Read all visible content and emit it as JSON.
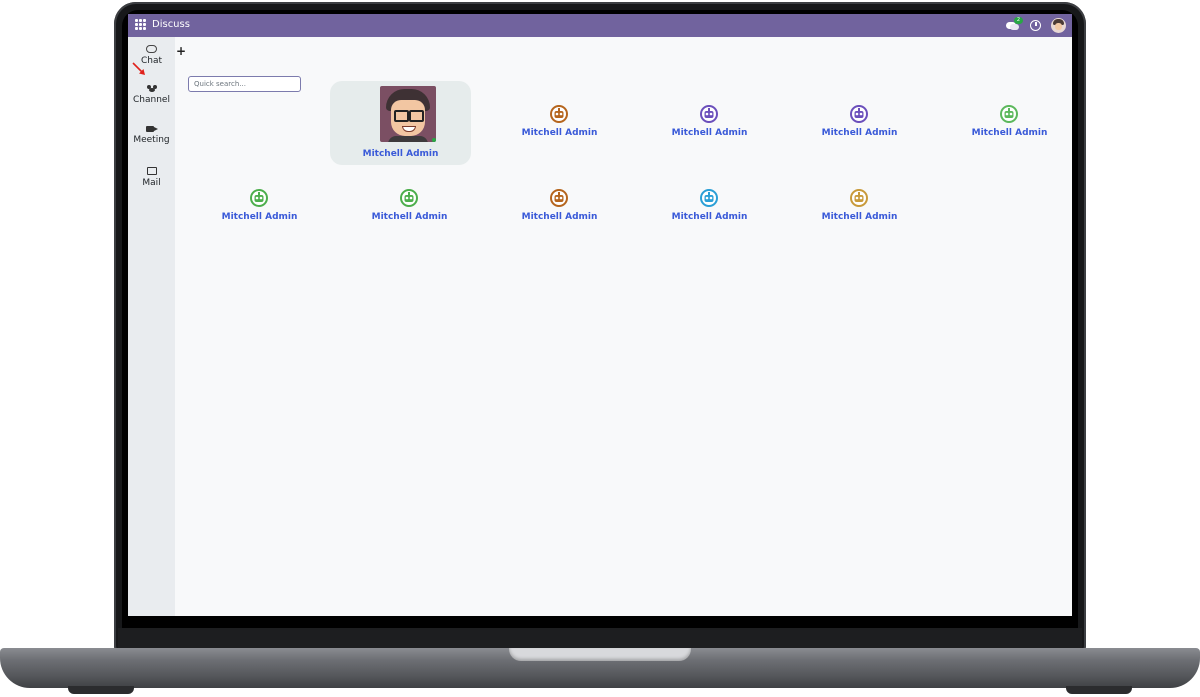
{
  "app": {
    "title": "Discuss"
  },
  "topbar": {
    "chat_badge": "2"
  },
  "sidebar": {
    "items": [
      {
        "label": "Chat",
        "icon": "chat-icon"
      },
      {
        "label": "Channel",
        "icon": "channel-icon"
      },
      {
        "label": "Meeting",
        "icon": "meeting-icon"
      },
      {
        "label": "Mail",
        "icon": "mail-icon"
      }
    ]
  },
  "search": {
    "placeholder": "Quick search..."
  },
  "contacts": [
    {
      "name": "Mitchell Admin",
      "avatar": "photo",
      "status": "online",
      "active": true
    },
    {
      "name": "Mitchell Admin",
      "avatar": "robot",
      "color": "#b5651d"
    },
    {
      "name": "Mitchell Admin",
      "avatar": "robot",
      "color": "#6b4fbb"
    },
    {
      "name": "Mitchell Admin",
      "avatar": "robot",
      "color": "#6b4fbb"
    },
    {
      "name": "Mitchell Admin",
      "avatar": "robot",
      "color": "#5cb85c"
    },
    {
      "name": "Mitchell Admin",
      "avatar": "robot",
      "color": "#4cae4c"
    },
    {
      "name": "Mitchell Admin",
      "avatar": "robot",
      "color": "#4cae4c"
    },
    {
      "name": "Mitchell Admin",
      "avatar": "robot",
      "color": "#b5651d"
    },
    {
      "name": "Mitchell Admin",
      "avatar": "robot",
      "color": "#2a9fd6"
    },
    {
      "name": "Mitchell Admin",
      "avatar": "robot",
      "color": "#c89a3a"
    }
  ],
  "colors": {
    "topbar": "#71639e",
    "link": "#3a5ad8",
    "annotation_arrow": "#e0211b"
  }
}
